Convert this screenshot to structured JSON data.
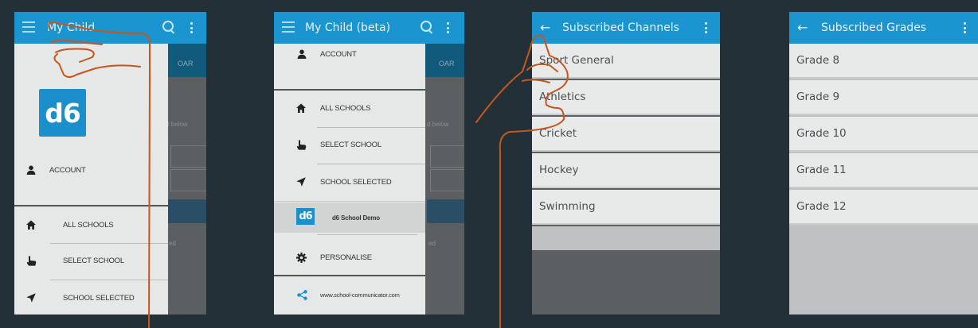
{
  "screens": [
    {
      "title": "My Child",
      "drawer": {
        "logo": "d6",
        "account": "ACCOUNT",
        "items": [
          "ALL SCHOOLS",
          "SELECT SCHOOL",
          "SCHOOL SELECTED"
        ]
      },
      "background": {
        "tab_fragment": "OAR",
        "hint_fragment": "d below",
        "footer_fragment": "ed"
      }
    },
    {
      "title": "My Child (beta)",
      "drawer": {
        "account": "ACCOUNT",
        "items": [
          "ALL SCHOOLS",
          "SELECT SCHOOL",
          "SCHOOL SELECTED"
        ],
        "school": {
          "logo": "d6",
          "name": "d6 School Demo"
        },
        "personalise": "PERSONALISE",
        "website": "www.school-communicator.com"
      },
      "background": {
        "tab_fragment": "OAR",
        "hint_fragment": "d below",
        "footer_fragment": "ed"
      }
    },
    {
      "title": "Subscribed Channels",
      "items": [
        "Sport General",
        "Athletics",
        "Cricket",
        "Hockey",
        "Swimming"
      ]
    },
    {
      "title": "Subscribed Grades",
      "items": [
        "Grade 8",
        "Grade 9",
        "Grade 10",
        "Grade 11",
        "Grade 12"
      ]
    }
  ],
  "colors": {
    "appbar": "#1a95cf",
    "background": "#243038",
    "ink": "#c4571f",
    "list_row": "#e8e9e9"
  },
  "icons": [
    "menu-icon",
    "search-icon",
    "overflow-menu-icon",
    "back-arrow-icon",
    "person-icon",
    "home-icon",
    "pointer-hand-icon",
    "navigation-arrow-icon",
    "gear-icon",
    "share-icon"
  ]
}
